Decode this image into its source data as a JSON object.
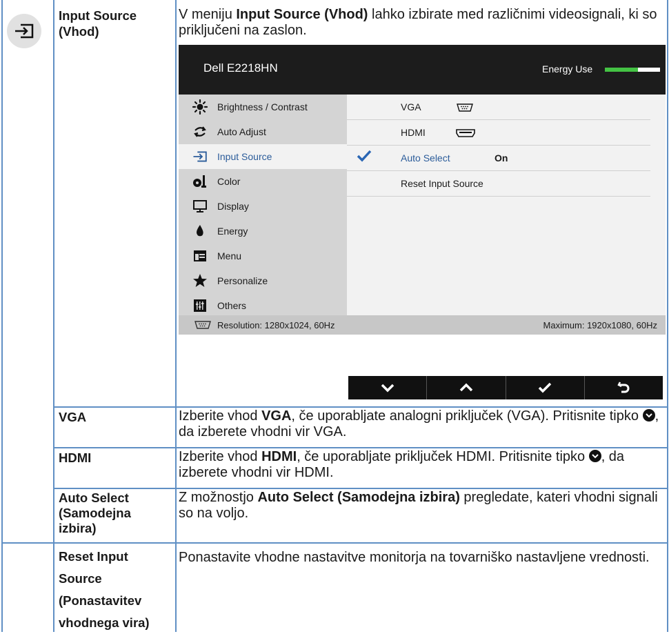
{
  "header": {
    "title_line1": "Input Source",
    "title_line2": "(Vhod)",
    "desc_pre": "V meniju ",
    "desc_bold": "Input Source (Vhod)",
    "desc_post": " lahko izbirate med različnimi videosignali, ki so priključeni na zaslon.",
    "icon": "input-source-icon"
  },
  "osd": {
    "title": "Dell E2218HN",
    "energy_label": "Energy Use",
    "energy_level": 0.6,
    "menu": [
      {
        "label": "Brightness / Contrast",
        "icon": "sun-icon"
      },
      {
        "label": "Auto Adjust",
        "icon": "auto-adjust-icon"
      },
      {
        "label": "Input Source",
        "icon": "input-source-icon",
        "selected": true
      },
      {
        "label": "Color",
        "icon": "color-icon"
      },
      {
        "label": "Display",
        "icon": "monitor-icon"
      },
      {
        "label": "Energy",
        "icon": "leaf-icon"
      },
      {
        "label": "Menu",
        "icon": "menu-window-icon"
      },
      {
        "label": "Personalize",
        "icon": "star-icon"
      },
      {
        "label": "Others",
        "icon": "sliders-icon"
      }
    ],
    "submenu": [
      {
        "label": "VGA",
        "icon": "vga-port-icon"
      },
      {
        "label": "HDMI",
        "icon": "hdmi-port-icon"
      },
      {
        "label": "Auto Select",
        "value": "On",
        "checked": true
      },
      {
        "label": "Reset Input Source"
      }
    ],
    "footer_resolution": "Resolution: 1280x1024, 60Hz",
    "footer_max": "Maximum: 1920x1080, 60Hz",
    "nav_buttons": [
      "down-icon",
      "up-icon",
      "check-icon",
      "back-icon"
    ]
  },
  "rows": [
    {
      "label": "VGA",
      "text_pre": "Izberite vhod ",
      "text_bold": "VGA",
      "text_mid": ", če uporabljate analogni priključek (VGA). Pritisnite tipko ",
      "text_post": ", da izberete vhodni vir VGA."
    },
    {
      "label": "HDMI",
      "text_pre": "Izberite vhod ",
      "text_bold": "HDMI",
      "text_mid": ", če uporabljate priključek HDMI. Pritisnite tipko ",
      "text_post": ", da izberete vhodni vir HDMI."
    },
    {
      "label_lines": [
        "Auto Select",
        "(Samodejna",
        "izbira)"
      ],
      "text_pre": "Z možnostjo ",
      "text_bold": "Auto Select (Samodejna izbira)",
      "text_post": " pregledate, kateri vhodni signali so na voljo."
    },
    {
      "label_lines": [
        "Reset Input",
        "Source",
        "(Ponastavitev",
        "vhodnega vira)"
      ],
      "text": "Ponastavite vhodne nastavitve monitorja na tovarniško nastavljene vrednosti."
    }
  ]
}
